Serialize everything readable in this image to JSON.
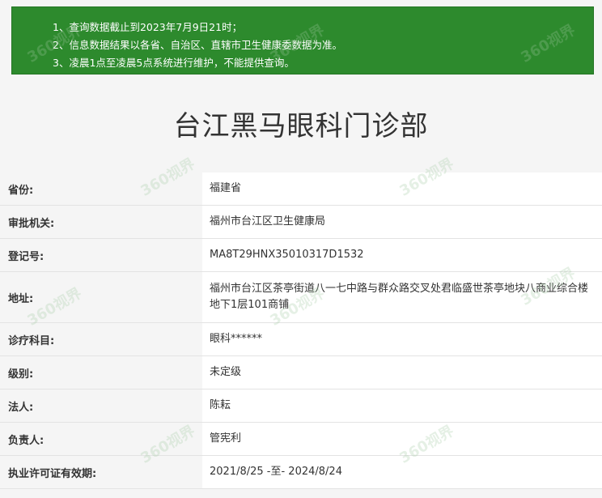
{
  "notice": {
    "lines": [
      "1、查询数据截止到2023年7月9日21时；",
      "2、信息数据结果以各省、自治区、直辖市卫生健康委数据为准。",
      "3、凌晨1点至凌晨5点系统进行维护，不能提供查询。"
    ]
  },
  "page_title": "台江黑马眼科门诊部",
  "rows": [
    {
      "label": "省份:",
      "value": "福建省"
    },
    {
      "label": "审批机关:",
      "value": "福州市台江区卫生健康局"
    },
    {
      "label": "登记号:",
      "value": "MA8T29HNX35010317D1532"
    },
    {
      "label": "地址:",
      "value": "福州市台江区茶亭街道八一七中路与群众路交叉处君临盛世茶亭地块八商业综合楼地下1层101商铺"
    },
    {
      "label": "诊疗科目:",
      "value": "眼科******"
    },
    {
      "label": "级别:",
      "value": "未定级"
    },
    {
      "label": "法人:",
      "value": "陈耘"
    },
    {
      "label": "负责人:",
      "value": "管宪利"
    },
    {
      "label": "执业许可证有效期:",
      "value": "2021/8/25 -至- 2024/8/24"
    }
  ],
  "watermark_text": "360视界",
  "colors": {
    "notice_bg": "#2d8a2d",
    "value_bg": "#ffffff",
    "label_bg": "#f5f5f5"
  }
}
